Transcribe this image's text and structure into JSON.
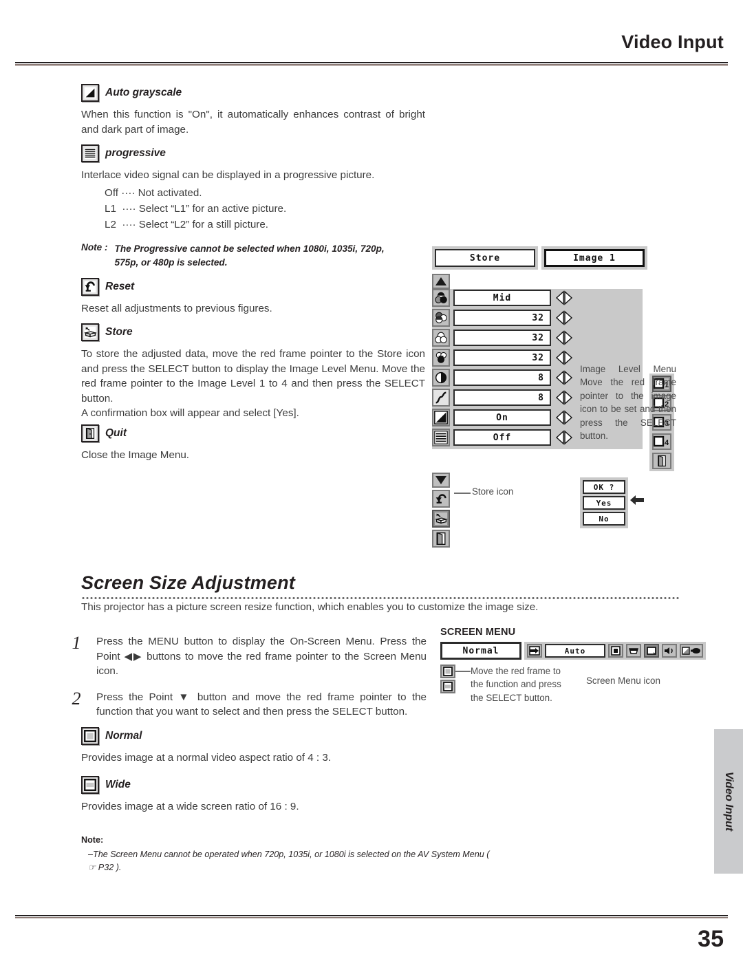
{
  "header": {
    "title": "Video Input",
    "page_number": "35",
    "side_tab": "Video Input"
  },
  "sections": {
    "auto_grayscale": {
      "icon": "auto-grayscale-icon",
      "heading": "Auto grayscale",
      "body": "When this function is \"On\", it automatically enhances contrast of bright and dark part of image."
    },
    "progressive": {
      "icon": "progressive-icon",
      "heading": "progressive",
      "body": "Interlace video signal can be displayed in a progressive picture.",
      "options": [
        "Off ···· Not activated.",
        "L1  ···· Select “L1” for an active picture.",
        "L2  ···· Select “L2” for a still picture."
      ],
      "note_label": "Note :",
      "note_text": "The Progressive cannot be selected when 1080i, 1035i, 720p, 575p, or 480p is selected."
    },
    "reset": {
      "icon": "reset-icon",
      "heading": "Reset",
      "body": "Reset all adjustments to previous figures."
    },
    "store": {
      "icon": "store-icon",
      "heading": "Store",
      "body": "To store the adjusted data, move the red frame pointer to the Store icon and press the SELECT button to display the Image Level Menu.  Move the red frame pointer to the Image Level 1 to 4 and then press the SELECT button.",
      "body2": "A confirmation box will appear and select [Yes]."
    },
    "quit": {
      "icon": "quit-icon",
      "heading": "Quit",
      "body": "Close the Image Menu."
    }
  },
  "image_menu_figure": {
    "title_left": "Store",
    "title_right": "Image 1",
    "rows": [
      {
        "icon": "color-temp-icon",
        "value": "Mid"
      },
      {
        "icon": "contrast-balance-icon",
        "value": "32"
      },
      {
        "icon": "red-level-icon",
        "value": "32"
      },
      {
        "icon": "green-level-icon",
        "value": "32"
      },
      {
        "icon": "contrast-icon",
        "value": "8"
      },
      {
        "icon": "gamma-icon",
        "value": "8"
      },
      {
        "icon": "auto-grayscale-icon",
        "value": "On"
      },
      {
        "icon": "progressive-icon",
        "value": "Off"
      }
    ],
    "level_buttons": [
      "1",
      "2",
      "3",
      "4"
    ],
    "level_quit_icon": "quit-icon",
    "caption": "Image Level Menu Move the red frame pointer to the image icon to be set and then press the SELECT button.",
    "store_icon_label": "Store icon",
    "confirm_dialog": {
      "prompt": "OK ?",
      "yes": "Yes",
      "no": "No"
    }
  },
  "screen_size": {
    "heading": "Screen Size Adjustment",
    "intro": "This projector has a picture screen resize function, which enables you to customize the image size.",
    "steps": [
      {
        "num": "1",
        "text": "Press the MENU button to display the On-Screen Menu.  Press the Point ◀▶ buttons to move the red frame pointer to the Screen Menu icon."
      },
      {
        "num": "2",
        "text": "Press the Point ▼ button and move the red frame pointer to the function that you want to select and then press the SELECT button."
      }
    ],
    "menu_figure": {
      "label": "SCREEN MENU",
      "value_left": "Normal",
      "value_right": "Auto",
      "icons": [
        "input-icon",
        "system-icon",
        "image-select-icon",
        "image-adjust-icon",
        "screen-icon",
        "sound-icon",
        "setting-icon"
      ],
      "callout": "Move the red frame to the function and press the SELECT button.",
      "icon_label": "Screen Menu icon"
    },
    "normal": {
      "icon": "normal-aspect-icon",
      "heading": "Normal",
      "body": "Provides image at a normal video aspect ratio of 4 : 3."
    },
    "wide": {
      "icon": "wide-aspect-icon",
      "heading": "Wide",
      "body": "Provides image at a wide screen ratio of 16 : 9."
    },
    "note_label": "Note:",
    "note_text": "–The Screen Menu cannot be operated when 720p, 1035i, or 1080i is selected on the AV System Menu  ( ☞ P32 )."
  }
}
